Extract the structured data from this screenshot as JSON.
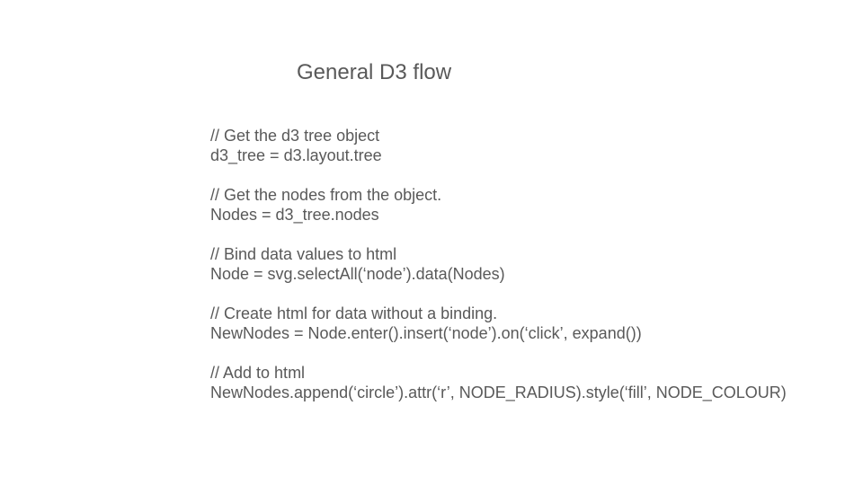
{
  "slide": {
    "title": "General D3 flow",
    "blocks": [
      {
        "comment": "// Get the d3 tree object",
        "code": "d3_tree = d3.layout.tree"
      },
      {
        "comment": "// Get the nodes from the object.",
        "code": "Nodes = d3_tree.nodes"
      },
      {
        "comment": "// Bind data values to html",
        "code": "Node = svg.selectAll(‘node’).data(Nodes)"
      },
      {
        "comment": "// Create html for data without a binding.",
        "code": "NewNodes = Node.enter().insert(‘node’).on(‘click’, expand())"
      },
      {
        "comment": "// Add to html",
        "code": "NewNodes.append(‘circle’).attr(‘r’, NODE_RADIUS).style(‘fill’, NODE_COLOUR)"
      }
    ]
  },
  "colors": {
    "background": "#ffffff",
    "text": "#595959"
  }
}
